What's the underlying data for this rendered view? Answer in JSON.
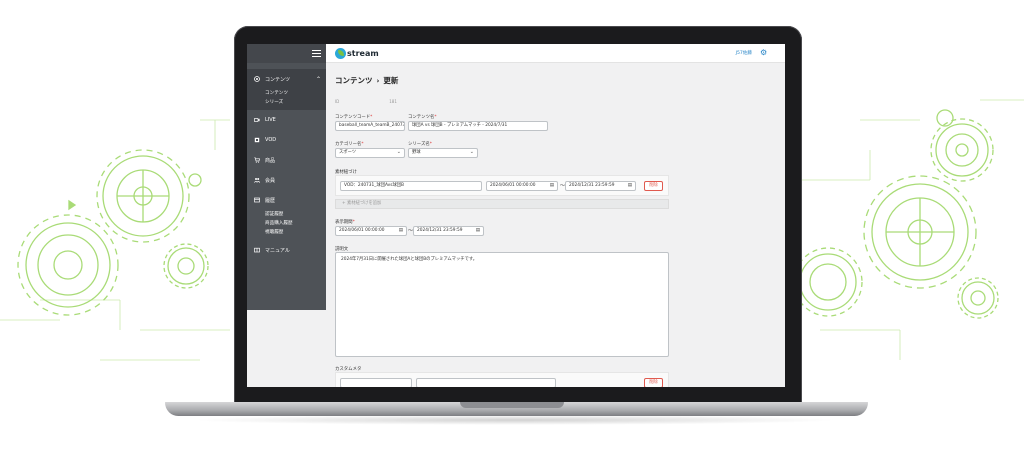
{
  "app": {
    "logo_text": "stream",
    "user_link": "J57佐藤"
  },
  "sidebar": {
    "items": [
      {
        "label": "コンテンツ",
        "icon": "target-icon"
      },
      {
        "label": "LIVE",
        "icon": "video-icon"
      },
      {
        "label": "VOD",
        "icon": "film-icon"
      },
      {
        "label": "商品",
        "icon": "cart-icon"
      },
      {
        "label": "会員",
        "icon": "users-icon"
      },
      {
        "label": "履歴",
        "icon": "history-icon"
      },
      {
        "label": "マニュアル",
        "icon": "book-icon"
      }
    ],
    "content_sub": [
      "コンテンツ",
      "シリーズ"
    ],
    "history_sub": [
      "認証履歴",
      "商品購入履歴",
      "視聴履歴"
    ]
  },
  "page": {
    "breadcrumb_parent": "コンテンツ",
    "breadcrumb_sep": "›",
    "breadcrumb_current": "更新",
    "id_label": "ID",
    "id_value": "181"
  },
  "form": {
    "content_code_label": "コンテンツコード",
    "content_code_value": "baseball_teamA_teamB_240731",
    "content_name_label": "コンテンツ名",
    "content_name_value": "球団A vs 球団B - プレミアムマッチ - 2024/7/31",
    "category_label": "カテゴリー名",
    "category_value": "スポーツ",
    "series_label": "シリーズ名",
    "series_value": "野球",
    "material_label": "素材紐づけ",
    "material_value": "VOD：240731_球団Avs球団B",
    "material_start": "2024/06/01 00:00:00",
    "material_end": "2024/12/31 23:59:59",
    "tilde": "〜",
    "delete_label": "削除",
    "add_material_label": "+ 素材紐づけを追加",
    "display_period_label": "表示期間",
    "display_start": "2024/06/01 00:00:00",
    "display_end": "2024/12/31 23:59:59",
    "description_label": "説明文",
    "description_value": "2024年7月31日に開催された球団Aと球団Bのプレミアムマッチです。",
    "custom_meta_label": "カスタムメタ",
    "required_mark": "*"
  },
  "colors": {
    "sidebar": "#4e5257",
    "accent": "#2b87c8",
    "danger": "#e05a4f",
    "gear": "#8fd14f"
  }
}
